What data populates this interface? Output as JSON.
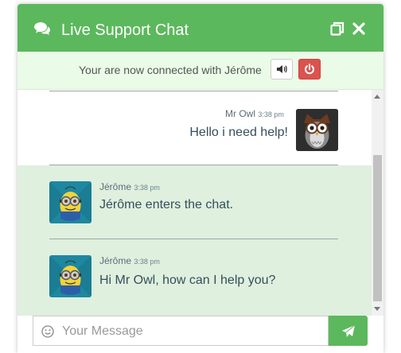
{
  "window": {
    "title": "Live Support Chat",
    "accent_color": "#5cb85c",
    "icons": [
      "chat-bubbles-icon",
      "restore-window-icon",
      "close-icon"
    ]
  },
  "status": {
    "text": "Your are now connected with Jérôme",
    "sound_icon": "volume-icon",
    "end_icon": "power-icon",
    "end_color": "#d9534f"
  },
  "messages": [
    {
      "sender": "Mr Owl",
      "time": "3:38 pm",
      "text": "Hello i need help!",
      "side": "right",
      "avatar": "owl-avatar"
    },
    {
      "sender": "Jérôme",
      "time": "3:38 pm",
      "text": "Jérôme enters the chat.",
      "side": "left",
      "avatar": "minion-avatar"
    },
    {
      "sender": "Jérôme",
      "time": "3:38 pm",
      "text": "Hi Mr Owl, how can I help you?",
      "side": "left",
      "avatar": "minion-avatar"
    }
  ],
  "composer": {
    "placeholder": "Your Message",
    "value": "",
    "emoji_icon": "smiley-icon",
    "send_icon": "paper-plane-icon"
  }
}
